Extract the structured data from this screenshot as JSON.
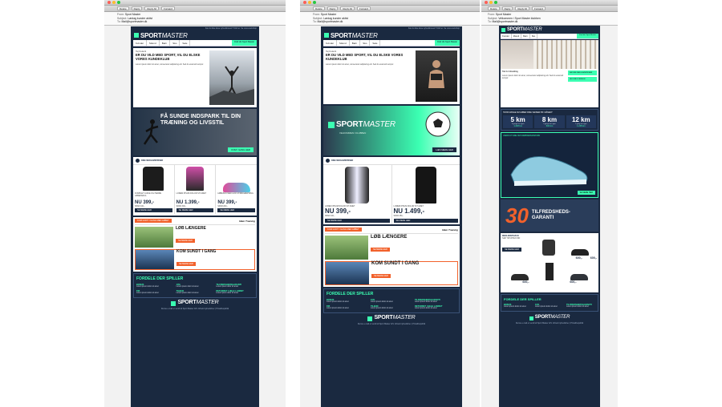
{
  "colors": {
    "navy": "#1a2940",
    "mint": "#3bffb2",
    "orange": "#f2612b"
  },
  "mail": {
    "toolbar_buttons": [
      "Delete",
      "Reply",
      "Reply All",
      "Forward"
    ],
    "windows": [
      {
        "from": "From:",
        "from_val": "Sport Master",
        "subject": "Subject:",
        "subject_val": "Lørdag kunder aktivt",
        "to": "To:",
        "to_val": "Mail@sportmaster.dk"
      },
      {
        "from": "From:",
        "from_val": "Sport Master",
        "subject": "Subject:",
        "subject_val": "Lørdag kunder aktivt",
        "to": "To:",
        "to_val": "Mail@sportmaster.dk"
      },
      {
        "from": "From:",
        "from_val": "Sport Master",
        "subject": "Subject:",
        "subject_val": "Velkommen i Sport Master klubben",
        "to": "To:",
        "to_val": "Mail@sportmaster.dk"
      }
    ]
  },
  "email": {
    "toplink": "Kan du ikke læse nyhedsbrevet? Klik her. Se vores webshop",
    "logo_a": "SPORT",
    "logo_b": "MASTER",
    "nav": [
      "Kvinder",
      "Mænd",
      "Børn",
      "Sko",
      "Sale"
    ],
    "nav_pill": "Find din Sport Master",
    "hero_greeting": "Hej Frederik",
    "hero_title": "ER DU VILD MED SPORT, VIL DU ELSKE VORES KUNDEKLUB",
    "hero_body": "Lorem ipsum dolor sit amet, consectetur adipiscing elit. Sed do eiusmod tempor.",
    "banner1_title": "FÅ SUNDE INDSPARK TIL DIN TRÆNING OG LIVSSTIL",
    "banner1_btn": "KOM I GANG HER",
    "members_title": "DINE MEDLEMSPRISER",
    "products": [
      {
        "name": "KOMPLET JAKKE OG HERRE LØBEPARKA",
        "price": "NU 399,-",
        "before": "SPAR 100,-"
      },
      {
        "name": "LOREM IPSUM DOLOR SIT AMET",
        "price": "NU 1.399,-",
        "before": "SPAR 300,-"
      },
      {
        "name": "LØBESKO MED GOD STØDDÆMPNING",
        "price": "NU 399,-",
        "before": "SPAR 200,-"
      }
    ],
    "se_mere": "SE MERE HER",
    "partner_text": "KOM GODT I GANG MED LØBET",
    "partner_logo": "Idéer Træning",
    "article1": "LØB LÆNGERE",
    "article2": "KOM SUNDT I GANG",
    "benefits_title": "FORDELE DER SPILLER",
    "benefits": [
      {
        "head": "BONUS",
        "text": "Lorem ipsum dolor sit amet"
      },
      {
        "head": "10%",
        "text": "Lorem ipsum dolor sit amet"
      },
      {
        "head": "TILFREDSHEDSGARANTI",
        "text": "Lorem ipsum dolor sit amet"
      },
      {
        "head": "FRI",
        "text": "Lorem ipsum dolor sit amet"
      },
      {
        "head": "TILBUD",
        "text": "Lorem ipsum dolor sit amet"
      },
      {
        "head": "RETURRET I HELE LANDET",
        "text": "Lorem ipsum dolor sit amet"
      }
    ],
    "footer": "Denne e-mail er sendt af Sport Master A/S. Afmeld nyhedsbrev | Privatlivspolitik",
    "banner2_btn": "LÆS MERE HER",
    "banner2_sub": "VELKOMMEN I KLUBBEN",
    "products2": [
      {
        "name": "LOREM IPSUM DOLOR SIT AMET",
        "price": "NU 399,-",
        "before": "SPAR 100,-"
      },
      {
        "name": "LOREM IPSUM DOLOR SIT AMET",
        "price": "NU 1.499,-",
        "before": "SPAR 250,-"
      }
    ],
    "stats_title": "HVOR MANGE KM LØBER DINE VENNER PR. MÅNED?",
    "stats": [
      {
        "km": "5 km",
        "sub": "3 gange om ugen"
      },
      {
        "km": "8 km",
        "sub": "2 gange om ugen"
      },
      {
        "km": "12 km",
        "sub": "1 gang om ugen"
      }
    ],
    "stats_sub": [
      "1.248 km",
      "632 km",
      "1.248 km"
    ],
    "shoe_title": "VÆRD AT VIDE OM KOMPRESSIONSTØJ",
    "guarantee_num": "30",
    "guarantee_text": "TILFREDSHEDS-GARANTI",
    "members3": "MEDLEMSTILBUD",
    "members3_sub": "SÆT SPURTEN IND",
    "prices3": [
      "600,-",
      "600,-",
      "600,-",
      "600,-"
    ],
    "welcome": "Tak for tilmelding",
    "side_btns": [
      "FÅ DINE MEDLEMSPRISER",
      "SE DINE FORDELE"
    ]
  }
}
